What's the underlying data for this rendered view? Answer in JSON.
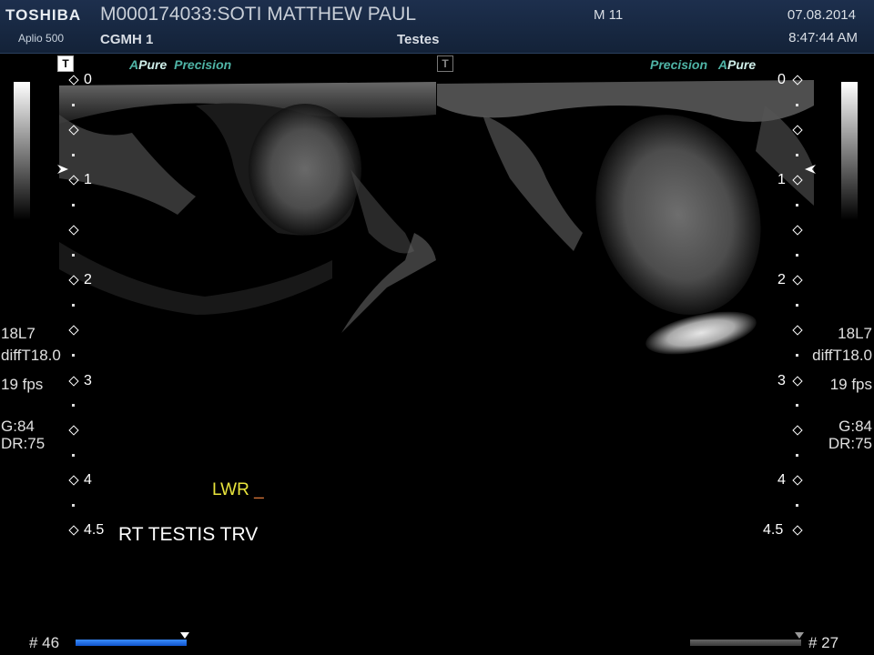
{
  "header": {
    "brand": "TOSHIBA",
    "model": "Aplio 500",
    "patient": "M000174033:SOTI MATTHEW PAUL",
    "hospital": "CGMH 1",
    "mode": "M 11",
    "exam": "Testes",
    "date": "07.08.2014",
    "time": "8:47:44 AM"
  },
  "left_panel": {
    "tbox": "T",
    "preset_a": "A",
    "preset_pure": "Pure",
    "preset_precision": "Precision",
    "params": [
      "18L7",
      "diffT18.0",
      "19 fps",
      "G:84",
      "DR:75"
    ]
  },
  "right_panel": {
    "tbox": "T",
    "preset_precision": "Precision",
    "preset_a": "A",
    "preset_pure": "Pure",
    "params": [
      "18L7",
      "diffT18.0",
      "19 fps",
      "G:84",
      "DR:75"
    ]
  },
  "depth_labels": [
    "0",
    "1",
    "2",
    "3",
    "4",
    "4.5"
  ],
  "annotation": {
    "lwr": "LWR",
    "cursor": "_",
    "caption": "RT TESTIS TRV"
  },
  "frames": {
    "left": "# 46",
    "right": "# 27"
  },
  "colors": {
    "preset_accent": "#4fb4a6",
    "annotation_yellow": "#e9e53c",
    "cine_bar_blue": "#1e6fe8"
  }
}
